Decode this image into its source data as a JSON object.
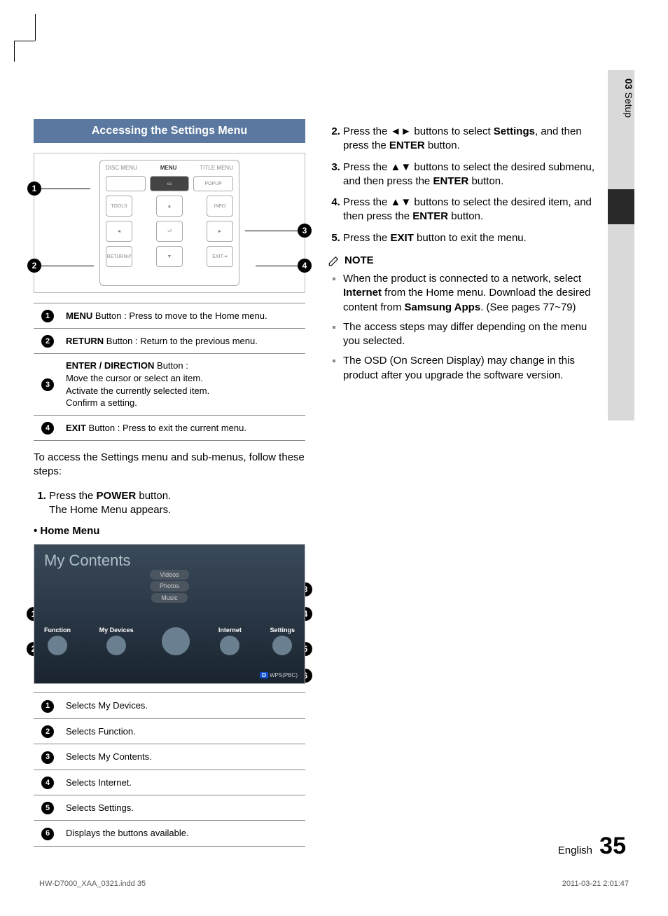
{
  "sidetab": {
    "chapter_num": "03",
    "chapter_title": "Setup"
  },
  "section_header": "Accessing the Settings Menu",
  "remote": {
    "top_labels": {
      "disc_menu": "DISC MENU",
      "menu": "MENU",
      "title_menu": "TITLE MENU"
    },
    "popup": "POPUP",
    "tools": "TOOLS",
    "info": "INFO",
    "return": "RETURN",
    "exit": "EXIT"
  },
  "legend1": [
    {
      "n": "1",
      "bold": "MENU",
      "rest": " Button : Press to move to the Home menu."
    },
    {
      "n": "2",
      "bold": "RETURN",
      "rest": " Button : Return to the previous menu."
    },
    {
      "n": "3",
      "bold": "ENTER / DIRECTION",
      "rest": " Button :\nMove the cursor or select an item.\nActivate the currently selected item.\nConfirm a setting."
    },
    {
      "n": "4",
      "bold": "EXIT",
      "rest": " Button : Press to exit the current menu."
    }
  ],
  "intro": "To access the Settings menu and sub-menus, follow these steps:",
  "step1_a": "Press the ",
  "step1_bold": "POWER",
  "step1_b": " button.\nThe Home Menu appears.",
  "home_menu_label": "• Home Menu",
  "home": {
    "title": "My Contents",
    "tabs": [
      "Videos",
      "Photos",
      "Music"
    ],
    "icons": [
      "Function",
      "My Devices",
      "",
      "Internet",
      "Settings"
    ],
    "footer_d": "D",
    "footer": "WPS(PBC)"
  },
  "legend2": [
    {
      "n": "1",
      "t": "Selects My Devices."
    },
    {
      "n": "2",
      "t": "Selects Function."
    },
    {
      "n": "3",
      "t": "Selects My Contents."
    },
    {
      "n": "4",
      "t": "Selects Internet."
    },
    {
      "n": "5",
      "t": "Selects Settings."
    },
    {
      "n": "6",
      "t": "Displays the buttons available."
    }
  ],
  "steps_right": {
    "s2_a": "Press the ◄► buttons to select ",
    "s2_bold1": "Settings",
    "s2_b": ", and then press the ",
    "s2_bold2": "ENTER",
    "s2_c": " button.",
    "s3_a": "Press the ▲▼ buttons to select the desired submenu, and then press the ",
    "s3_bold": "ENTER",
    "s3_b": " button.",
    "s4_a": "Press the ▲▼ buttons to select the desired item, and then press the ",
    "s4_bold": "ENTER",
    "s4_b": " button.",
    "s5_a": "Press the ",
    "s5_bold": "EXIT",
    "s5_b": " button to exit the menu."
  },
  "note_label": "NOTE",
  "notes": {
    "n1_a": "When the product is connected to a network, select ",
    "n1_b1": "Internet",
    "n1_b": " from the Home menu. Download the desired content from ",
    "n1_b2": "Samsung Apps",
    "n1_c": ". (See pages 77~79)",
    "n2": "The access steps may differ depending on the menu you selected.",
    "n3": "The OSD (On Screen Display) may change in this product after you upgrade the software version."
  },
  "footer": {
    "lang": "English",
    "page": "35"
  },
  "print": {
    "file": "HW-D7000_XAA_0321.indd   35",
    "date": "2011-03-21   2:01:47"
  }
}
